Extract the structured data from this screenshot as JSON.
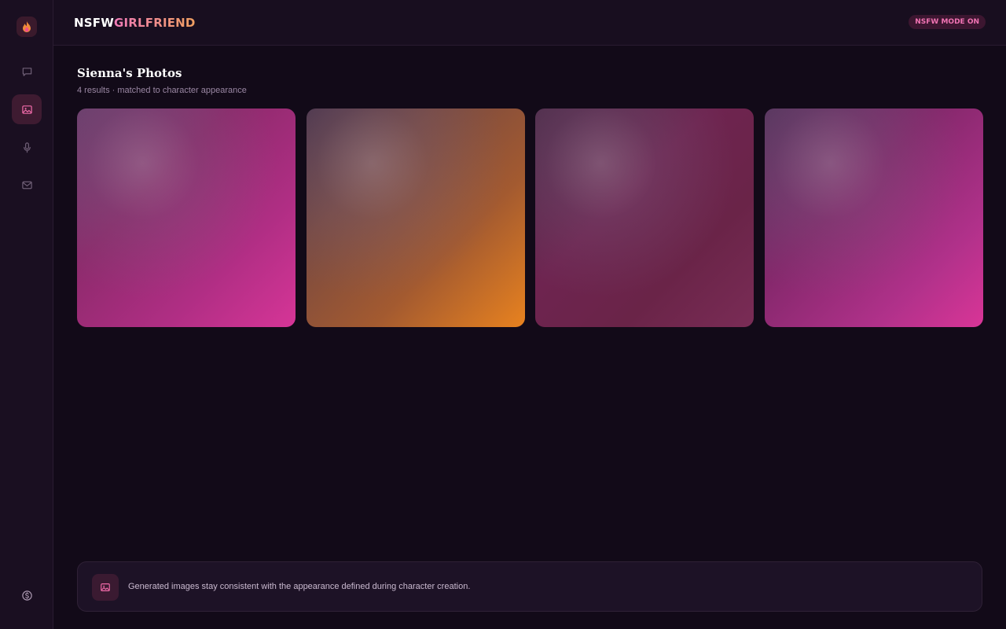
{
  "brand": {
    "part1": "NSFW",
    "part2": "GIRLFRIEND"
  },
  "header": {
    "badge": "NSFW MODE ON"
  },
  "sidebar": {
    "items": [
      {
        "name": "chat",
        "icon": "chat-bubble-icon",
        "active": false
      },
      {
        "name": "photos",
        "icon": "image-icon",
        "active": true
      },
      {
        "name": "voice",
        "icon": "microphone-icon",
        "active": false
      },
      {
        "name": "messages",
        "icon": "mail-icon",
        "active": false
      }
    ],
    "bottom_icon": "coin-icon"
  },
  "page": {
    "title": "Sienna's Photos",
    "subtitle": "4 results · matched to character appearance"
  },
  "photos": [
    {
      "id": "photo-1",
      "tint": "#d63597"
    },
    {
      "id": "photo-2",
      "tint": "#e8821f"
    },
    {
      "id": "photo-3",
      "tint": "#7a2c56"
    },
    {
      "id": "photo-4",
      "tint": "#d93597"
    }
  ],
  "note": {
    "icon": "image-icon",
    "text": "Generated images stay consistent with the appearance defined during character creation."
  },
  "colors": {
    "accent": "#ef6aa8",
    "background": "#120a18",
    "sidebar": "#1a0f21"
  }
}
